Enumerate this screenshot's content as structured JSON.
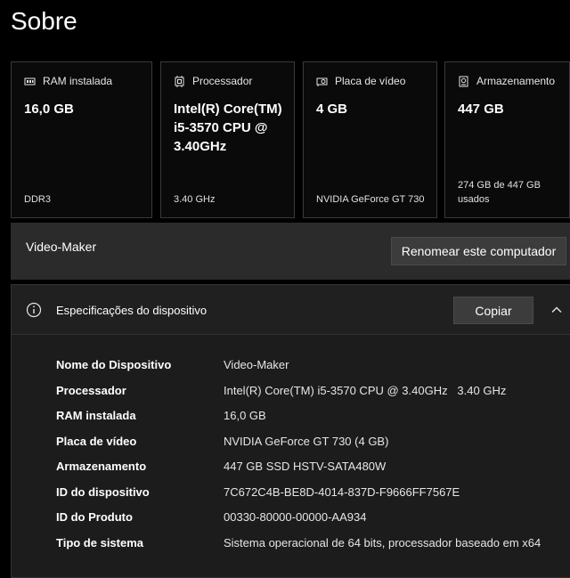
{
  "page": {
    "title": "Sobre"
  },
  "cards": [
    {
      "label": "RAM instalada",
      "icon": "ram-icon",
      "value": "16,0 GB",
      "detail": "DDR3"
    },
    {
      "label": "Processador",
      "icon": "cpu-icon",
      "value": "Intel(R) Core(TM) i5-3570 CPU @ 3.40GHz",
      "detail": "3.40 GHz"
    },
    {
      "label": "Placa de vídeo",
      "icon": "gpu-icon",
      "value": "4 GB",
      "detail": "NVIDIA GeForce GT 730"
    },
    {
      "label": "Armazenamento",
      "icon": "storage-icon",
      "value": "447 GB",
      "detail": "274 GB de 447 GB usados"
    }
  ],
  "device": {
    "name": "Video-Maker",
    "rename_label": "Renomear este computador"
  },
  "specs": {
    "title": "Especificações do dispositivo",
    "copy_label": "Copiar",
    "rows": [
      {
        "key": "Nome do Dispositivo",
        "value": "Video-Maker"
      },
      {
        "key": "Processador",
        "value": "Intel(R) Core(TM) i5-3570 CPU @ 3.40GHz   3.40 GHz"
      },
      {
        "key": "RAM instalada",
        "value": "16,0 GB"
      },
      {
        "key": "Placa de vídeo",
        "value": "NVIDIA GeForce GT 730 (4 GB)"
      },
      {
        "key": "Armazenamento",
        "value": "447 GB SSD HSTV-SATA480W"
      },
      {
        "key": "ID do dispositivo",
        "value": "7C672C4B-BE8D-4014-837D-F9666FF7567E"
      },
      {
        "key": "ID do Produto",
        "value": "00330-80000-00000-AA934"
      },
      {
        "key": "Tipo de sistema",
        "value": "Sistema operacional de 64 bits, processador baseado em x64"
      }
    ]
  },
  "colors": {
    "background": "#000000",
    "card": "#0a0a0a",
    "panel": "#1c1c1c",
    "button": "#3c3c3c"
  }
}
